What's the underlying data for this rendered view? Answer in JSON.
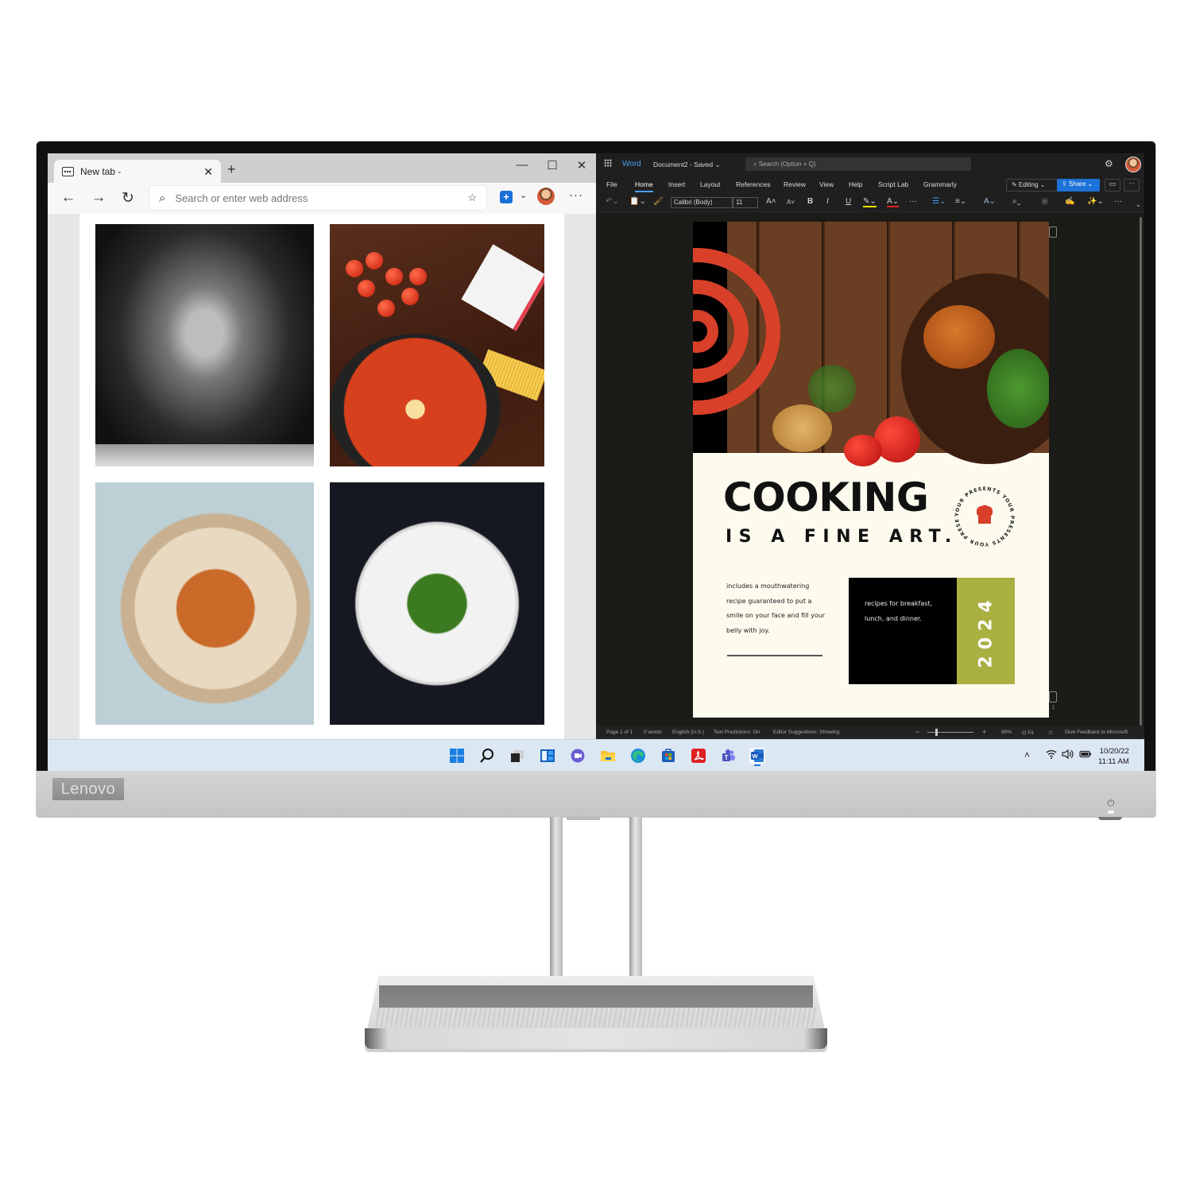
{
  "device": {
    "brand": "Lenovo"
  },
  "browser": {
    "tab": {
      "label": "New tab -",
      "close": "✕"
    },
    "new_tab": "+",
    "window_controls": {
      "minimize": "—",
      "maximize": "☐",
      "close": "✕"
    },
    "nav": {
      "back": "←",
      "forward": "→",
      "refresh": "↻"
    },
    "address": {
      "placeholder": "Search or enter web address",
      "value": ""
    },
    "favorites_icon": "☆",
    "collections_label": "+",
    "dropdown": "⌄",
    "more": "···",
    "gallery": [
      {
        "name": "flour-hands"
      },
      {
        "name": "shakshuka-tomatoes"
      },
      {
        "name": "sweet-potato-fries-bowl"
      },
      {
        "name": "greek-salad-plate"
      }
    ]
  },
  "word": {
    "app_name": "Word",
    "document_title": "Document2 - Saved ⌄",
    "search_placeholder": "⌕  Search (Option + Q)",
    "ribbon_tabs": [
      "File",
      "Home",
      "Insert",
      "Layout",
      "References",
      "Review",
      "View",
      "Help",
      "Script Lab",
      "Grammarly"
    ],
    "active_tab": "Home",
    "editing_label": "✎ Editing ⌄",
    "share_label": "⇪ Share ⌄",
    "comment_icon": "▭",
    "more": "···",
    "toolbar": {
      "undo": "↶⌄",
      "paste": "📋⌄",
      "format_painter": "🖌",
      "font": "Calibri (Body)",
      "font_chevron": "⌄",
      "size": "11",
      "grow": "A˄",
      "shrink": "A˅",
      "bold": "B",
      "italic": "I",
      "underline": "U",
      "highlight": "✎⌄",
      "font_color": "A⌄",
      "more1": "···",
      "bullets": "☰⌄",
      "align": "≡⌄",
      "styles": "A⌄",
      "find": "⌕⌄",
      "dictate": "▣",
      "editor": "✍",
      "designer": "✨⌄",
      "more2": "···",
      "collapse": "⌄"
    },
    "cover": {
      "title": "COOKING",
      "subtitle": "IS A FINE ART.",
      "badge_text": "YOUR PRESENTS YOUR PRESENTS YOUR PRESENTS",
      "body": "includes a mouthwatering recipe guaranteed to put a smile on your face and fill your belly with joy.",
      "box_text": "recipes for breakfast, lunch, and dinner.",
      "year": "2024",
      "accent_red": "#d8402a",
      "accent_olive": "#aaaf42"
    },
    "page_number_marker": "1",
    "status": {
      "page": "Page 1 of 1",
      "words": "0 words",
      "language": "English (U.S.)",
      "predictions": "Text Predictions: On",
      "editor": "Editor Suggestions: Showing",
      "zoom_out": "−",
      "zoom_in": "+",
      "zoom": "90%",
      "fit": "⊡ Fit",
      "brightness": "☼",
      "feedback": "Give Feedback to Microsoft"
    }
  },
  "taskbar": {
    "apps": [
      "start",
      "search",
      "task-view",
      "widgets",
      "chat",
      "file-explorer",
      "edge",
      "store",
      "acrobat",
      "teams",
      "word"
    ],
    "tray": {
      "chevron": "˄",
      "wifi": "📶",
      "volume": "🔈",
      "battery": "▭"
    },
    "date": "10/20/22",
    "time": "11:11 AM"
  }
}
